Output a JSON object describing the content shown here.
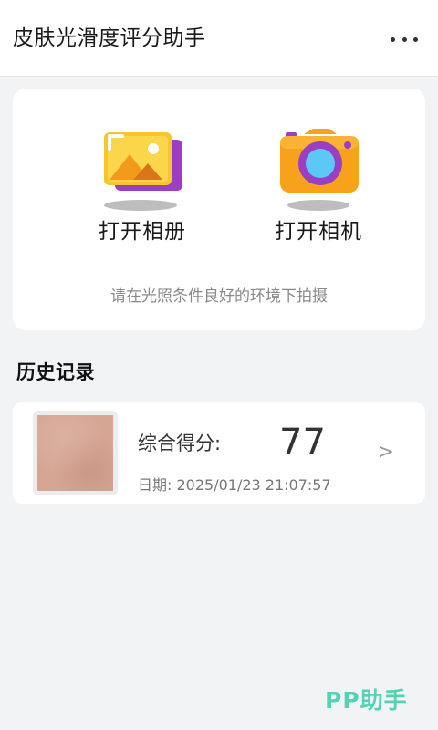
{
  "app": {
    "title": "皮肤光滑度评分助手"
  },
  "actions": {
    "album_label": "打开相册",
    "camera_label": "打开相机",
    "hint": "请在光照条件良好的环境下拍摄"
  },
  "history": {
    "section_title": "历史记录",
    "items": [
      {
        "score_label": "综合得分:",
        "score": "77",
        "date": "日期: 2025/01/23 21:07:57",
        "chevron": ">"
      }
    ]
  },
  "watermark": "PP助手",
  "colors": {
    "background": "#f2f3f5",
    "accent": "#52d4b4",
    "album_purple": "#9a3fc4",
    "album_yellow": "#f7c52e",
    "camera_orange": "#f8a21c",
    "camera_lens": "#5bc8f5"
  },
  "icons": {
    "menu": "more-horizontal-icon",
    "album": "photo-album-icon",
    "camera": "camera-icon"
  }
}
